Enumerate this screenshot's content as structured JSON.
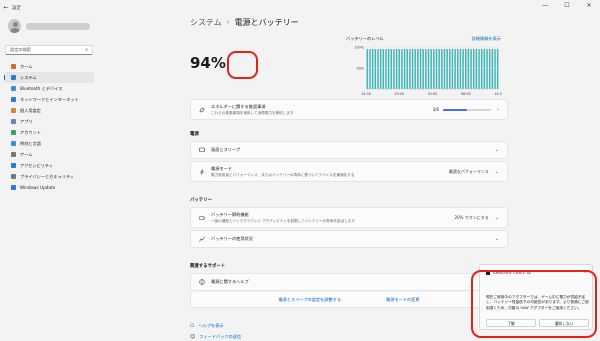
{
  "window": {
    "app_title": "設定",
    "controls": [
      "—",
      "☐",
      "✕"
    ]
  },
  "sidebar": {
    "search_placeholder": "設定の検索",
    "items": [
      {
        "label": "ホーム",
        "icon": "home-icon",
        "color": "#c96a3a"
      },
      {
        "label": "システム",
        "icon": "system-icon",
        "color": "#2b7bd3",
        "active": true
      },
      {
        "label": "Bluetooth とデバイス",
        "icon": "bluetooth-icon",
        "color": "#3a8de0"
      },
      {
        "label": "ネットワークとインターネット",
        "icon": "network-icon",
        "color": "#2b7bd3"
      },
      {
        "label": "個人用設定",
        "icon": "brush-icon",
        "color": "#d08a3a"
      },
      {
        "label": "アプリ",
        "icon": "apps-icon",
        "color": "#6a7ec0"
      },
      {
        "label": "アカウント",
        "icon": "account-icon",
        "color": "#2fa36b"
      },
      {
        "label": "時刻と言語",
        "icon": "clock-icon",
        "color": "#3a8de0"
      },
      {
        "label": "ゲーム",
        "icon": "game-icon",
        "color": "#777777"
      },
      {
        "label": "アクセシビリティ",
        "icon": "accessibility-icon",
        "color": "#2b7bd3"
      },
      {
        "label": "プライバシーとセキュリティ",
        "icon": "shield-icon",
        "color": "#777777"
      },
      {
        "label": "Windows Update",
        "icon": "update-icon",
        "color": "#2b7bd3"
      }
    ]
  },
  "header": {
    "crumb": "システム",
    "current": "電源とバッテリー"
  },
  "battery": {
    "percent_label": "94%"
  },
  "chart_data": {
    "type": "bar",
    "title": "バッテリーのレベル",
    "link": "詳細情報を表示",
    "yticks": [
      "100%",
      "50%"
    ],
    "ylim": [
      0,
      100
    ],
    "xticks": [
      "14:00",
      "20:00",
      "02:00",
      "08:00",
      "14:00"
    ],
    "values": [
      95,
      95,
      95,
      95,
      95,
      95,
      95,
      95,
      95,
      95,
      95,
      95,
      95,
      95,
      95,
      95,
      95,
      95,
      95,
      95,
      95,
      95,
      95,
      95,
      95,
      95,
      95,
      95,
      95,
      95,
      95,
      95,
      95,
      95,
      95,
      95,
      95,
      95,
      95,
      95,
      95,
      95,
      95,
      95,
      95,
      95,
      95,
      95,
      95,
      95
    ],
    "color": "#3db5b8"
  },
  "energy_card": {
    "title": "エネルギーに関する推奨事項",
    "desc": "これらの推奨事項を適用して消費電力を節約します",
    "value": "3/6",
    "progress": 0.5
  },
  "power_section": {
    "label": "電源",
    "screen_sleep": "画面とスリープ",
    "mode_title": "電源モード",
    "mode_desc": "電力使用量とパフォーマンス、またはバッテリーの寿命に基づいてデバイスを最適化する",
    "mode_value": "最適なパフォーマンス"
  },
  "battery_section": {
    "label": "バッテリー",
    "saver_title": "バッテリー節約機能",
    "saver_desc": "一部の通知とバックグラウンド アクティビティを制限してバッテリーの寿命を延ばします",
    "saver_value": "20% でオンにする",
    "usage_title": "バッテリーの使用状況"
  },
  "support_section": {
    "label": "関連するサポート",
    "help_title": "電源に関するヘルプ",
    "link1": "電源とスリープの設定を調整する",
    "link2": "電源モードの変更"
  },
  "bottom_links": {
    "get_help": "ヘルプを表示",
    "feedback": "フィードバックの送信"
  },
  "toast": {
    "app_name": "ARMOURY CRATE SE",
    "body": "現在ご使用中のアダプターでは、ゲーム中に電力が供給不足し、バッテリー残量低下の可能性があります。より快適にご使用頂くため、付属の 90W アダプターをご使用ください。",
    "ok": "了解",
    "dismiss": "通知しない"
  }
}
